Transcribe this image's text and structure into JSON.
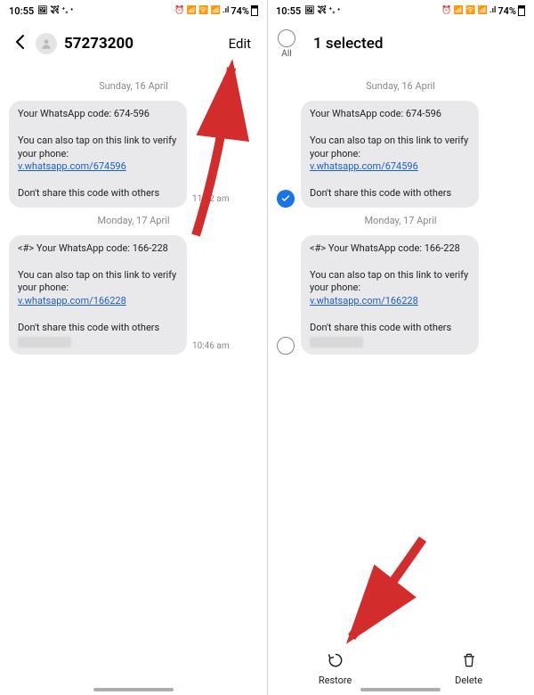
{
  "status": {
    "time": "10:55",
    "left_icons": "🖼 ✈ ⁺₊ •",
    "right_icons": "⏰ 📶 🛜 📶 .ıl",
    "battery": "74%"
  },
  "panel_a": {
    "contact": "57273200",
    "edit_label": "Edit",
    "date1": "Sunday, 16 April",
    "msg1": {
      "line1": "Your WhatsApp code: 674-596",
      "line2a": "You can also tap on this link to verify your phone: ",
      "link": "v.whatsapp.com/674596",
      "line3": "Don't share this code with others",
      "time": "11:42 am"
    },
    "date2": "Monday, 17 April",
    "msg2": {
      "line1": "<#> Your WhatsApp code: 166-228",
      "line2a": "You can also tap on this link to verify your phone: ",
      "link": "v.whatsapp.com/166228",
      "line3": "Don't share this code with others",
      "time": "10:46 am"
    }
  },
  "panel_b": {
    "all_label": "All",
    "sel_title": "1 selected",
    "date1": "Sunday, 16 April",
    "msg1": {
      "line1": "Your WhatsApp code: 674-596",
      "line2a": "You can also tap on this link to verify your phone: ",
      "link": "v.whatsapp.com/674596",
      "line3": "Don't share this code with others"
    },
    "date2": "Monday, 17 April",
    "msg2": {
      "line1": "<#> Your WhatsApp code: 166-228",
      "line2a": "You can also tap on this link to verify your phone: ",
      "link": "v.whatsapp.com/166228",
      "line3": "Don't share this code with others"
    },
    "restore_label": "Restore",
    "delete_label": "Delete"
  },
  "colors": {
    "accent": "#1a73e8",
    "link": "#1a5ec8",
    "arrow": "#d22c2c"
  }
}
